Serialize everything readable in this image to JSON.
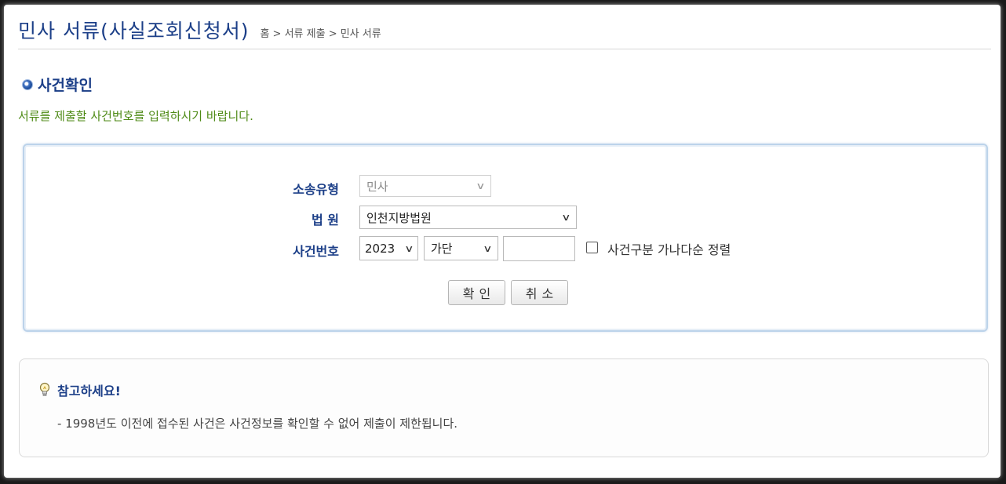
{
  "header": {
    "title": "민사 서류(사실조회신청서)",
    "breadcrumb": "홈 > 서류 제출 > 민사 서류"
  },
  "section": {
    "title": "사건확인",
    "instruction": "서류를 제출할 사건번호를 입력하시기 바랍니다."
  },
  "form": {
    "case_type": {
      "label": "소송유형",
      "value": "민사",
      "disabled": true
    },
    "court": {
      "label": "법 원",
      "value": "인천지방법원"
    },
    "case_number": {
      "label": "사건번호",
      "year": "2023",
      "category": "가단",
      "number": "",
      "sort_checkbox_label": "사건구분 가나다순 정렬",
      "sort_checked": false
    },
    "confirm_label": "확인",
    "cancel_label": "취소"
  },
  "notice": {
    "title": "참고하세요!",
    "text": "- 1998년도 이전에 접수된 사건은 사건정보를 확인할 수 없어 제출이 제한됩니다."
  },
  "colors": {
    "title_blue": "#1c3f88",
    "instruction_green": "#4e8a16",
    "form_border": "#bcd3ea"
  },
  "icons": {
    "section_bullet": "bullet-icon",
    "notice": "lightbulb-icon",
    "dropdown": "chevron-down-icon"
  }
}
